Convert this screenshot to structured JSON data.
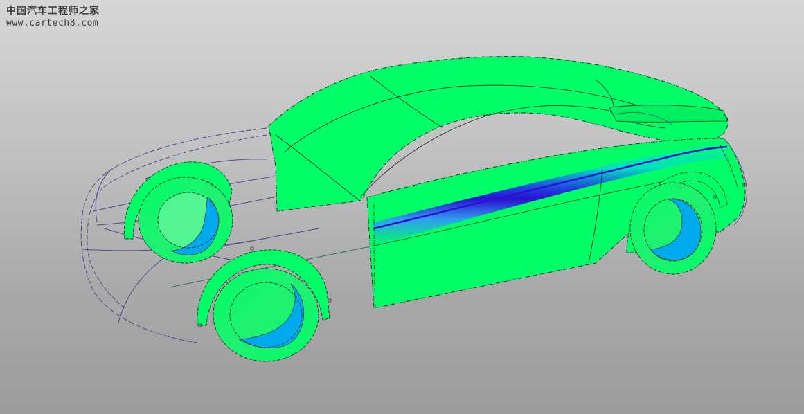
{
  "watermark": {
    "title": "中国汽车工程师之家",
    "url": "www.cartech8.com"
  },
  "colors": {
    "surface_green": "#00ff66",
    "tire_blue": "#00aaee",
    "highlight_blue": "#2a1ad8",
    "wire_blue": "#4a4a8a",
    "edge_dark": "#1f2f28"
  }
}
